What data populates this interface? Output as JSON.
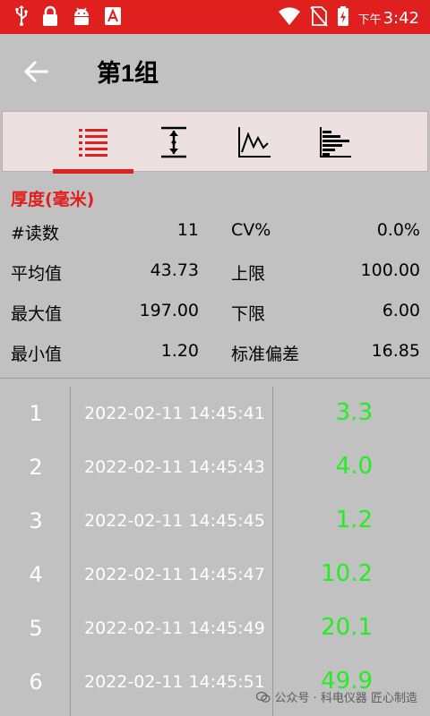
{
  "status_bar": {
    "ampm": "下午",
    "time": "3:42"
  },
  "header": {
    "title": "第1组"
  },
  "tabs": [
    {
      "name": "list",
      "icon": "list-icon"
    },
    {
      "name": "limits",
      "icon": "thickness-limit-icon"
    },
    {
      "name": "trend",
      "icon": "line-chart-icon"
    },
    {
      "name": "histogram",
      "icon": "histogram-icon"
    }
  ],
  "summary": {
    "title": "厚度(毫米)",
    "left": [
      {
        "label": "#读数",
        "value": "11"
      },
      {
        "label": "平均值",
        "value": "43.73"
      },
      {
        "label": "最大值",
        "value": "197.00"
      },
      {
        "label": "最小值",
        "value": "1.20"
      }
    ],
    "right": [
      {
        "label": "CV%",
        "value": "0.0%"
      },
      {
        "label": "上限",
        "value": "100.00"
      },
      {
        "label": "下限",
        "value": "6.00"
      },
      {
        "label": "标准偏差",
        "value": "16.85"
      }
    ]
  },
  "readings": [
    {
      "index": "1",
      "timestamp": "2022-02-11 14:45:41",
      "value": "3.3"
    },
    {
      "index": "2",
      "timestamp": "2022-02-11 14:45:43",
      "value": "4.0"
    },
    {
      "index": "3",
      "timestamp": "2022-02-11 14:45:45",
      "value": "1.2"
    },
    {
      "index": "4",
      "timestamp": "2022-02-11 14:45:47",
      "value": "10.2"
    },
    {
      "index": "5",
      "timestamp": "2022-02-11 14:45:49",
      "value": "20.1"
    },
    {
      "index": "6",
      "timestamp": "2022-02-11 14:45:51",
      "value": "49.9"
    }
  ],
  "watermark": {
    "text": "公众号 · 科电仪器 匠心制造"
  },
  "colors": {
    "accent": "#e0201f",
    "background": "#c1c1c1",
    "value_green": "#22ee22"
  }
}
